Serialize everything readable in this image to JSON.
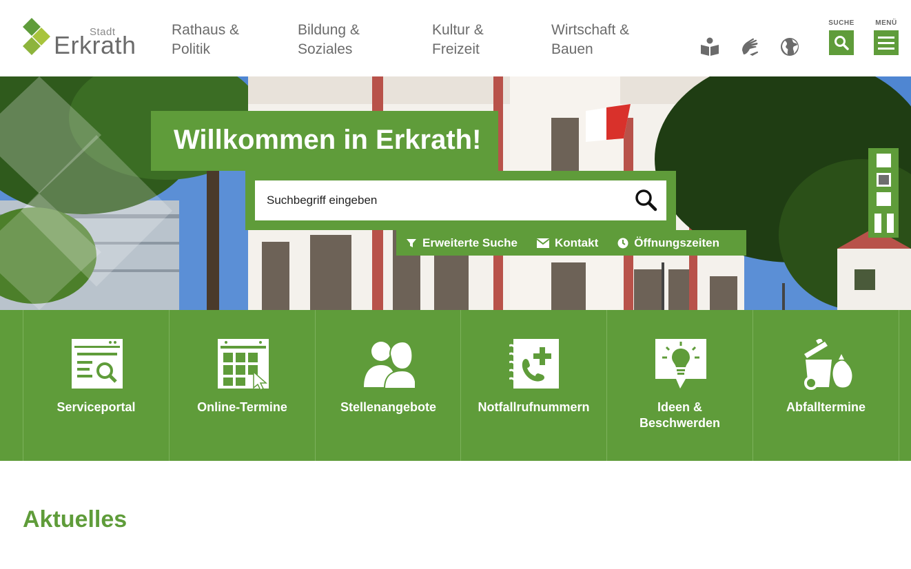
{
  "brand": {
    "logo_small": "Stadt",
    "logo_big": "Erkrath",
    "green": "#5f9c3a",
    "lime": "#a8c43c"
  },
  "nav": [
    {
      "label": "Rathaus &\nPolitik"
    },
    {
      "label": "Bildung &\nSoziales"
    },
    {
      "label": "Kultur &\nFreizeit"
    },
    {
      "label": "Wirtschaft &\nBauen"
    }
  ],
  "utility_icons": [
    "easy-language-icon",
    "sign-language-icon",
    "globe-icon"
  ],
  "header_buttons": {
    "search_label": "SUCHE",
    "menu_label": "MENÜ"
  },
  "hero": {
    "welcome": "Willkommen in Erkrath!",
    "search_placeholder": "Suchbegriff eingeben",
    "quick_links": [
      "Erweiterte Suche",
      "Kontakt",
      "Öffnungszeiten"
    ],
    "slides": {
      "count": 3,
      "active_index": 2
    }
  },
  "tiles": [
    {
      "label": "Serviceportal",
      "icon": "service-portal-icon"
    },
    {
      "label": "Online-Termine",
      "icon": "calendar-icon"
    },
    {
      "label": "Stellenangebote",
      "icon": "people-icon"
    },
    {
      "label": "Notfallrufnummern",
      "icon": "phone-book-icon"
    },
    {
      "label": "Ideen &\nBeschwerden",
      "icon": "lightbulb-icon"
    },
    {
      "label": "Abfalltermine",
      "icon": "waste-bin-icon"
    }
  ],
  "section": {
    "title": "Aktuelles"
  }
}
